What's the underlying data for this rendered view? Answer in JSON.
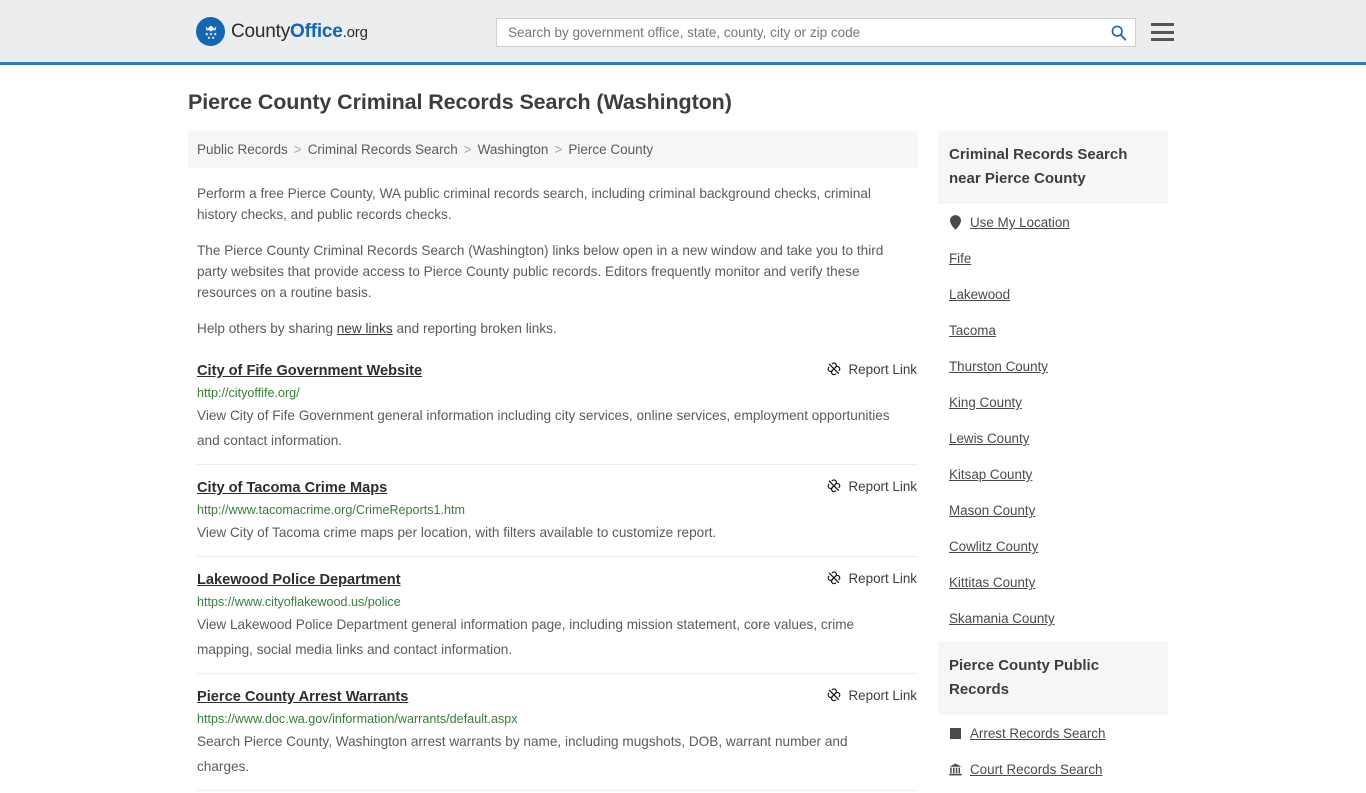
{
  "header": {
    "brand": {
      "part1": "County",
      "part2": "Office",
      "part3": ".org",
      "logo_icon": "eagle-stars-logo"
    },
    "search": {
      "placeholder": "Search by government office, state, county, city or zip code",
      "value": ""
    },
    "menu_label": "Menu"
  },
  "page": {
    "title": "Pierce County Criminal Records Search (Washington)"
  },
  "breadcrumb": [
    {
      "label": "Public Records"
    },
    {
      "label": "Criminal Records Search"
    },
    {
      "label": "Washington"
    },
    {
      "label": "Pierce County"
    }
  ],
  "breadcrumb_separator": ">",
  "intro": {
    "p1": "Perform a free Pierce County, WA public criminal records search, including criminal background checks, criminal history checks, and public records checks.",
    "p2": "The Pierce County Criminal Records Search (Washington) links below open in a new window and take you to third party websites that provide access to Pierce County public records. Editors frequently monitor and verify these resources on a routine basis.",
    "p3_before": "Help others by sharing ",
    "p3_link": "new links",
    "p3_after": " and reporting broken links."
  },
  "report_link_label": "Report Link",
  "results": [
    {
      "title": "City of Fife Government Website",
      "url": "http://cityoffife.org/",
      "description": "View City of Fife Government general information including city services, online services, employment opportunities and contact information."
    },
    {
      "title": "City of Tacoma Crime Maps",
      "url": "http://www.tacomacrime.org/CrimeReports1.htm",
      "description": "View City of Tacoma crime maps per location, with filters available to customize report."
    },
    {
      "title": "Lakewood Police Department",
      "url": "https://www.cityoflakewood.us/police",
      "description": "View Lakewood Police Department general information page, including mission statement, core values, crime mapping, social media links and contact information."
    },
    {
      "title": "Pierce County Arrest Warrants",
      "url": "https://www.doc.wa.gov/information/warrants/default.aspx",
      "description": "Search Pierce County, Washington arrest warrants by name, including mugshots, DOB, warrant number and charges."
    }
  ],
  "sidebar": {
    "nearby": {
      "heading": "Criminal Records Search near Pierce County",
      "items": [
        {
          "label": "Use My Location",
          "icon": "map-pin-icon"
        },
        {
          "label": "Fife",
          "icon": ""
        },
        {
          "label": "Lakewood",
          "icon": ""
        },
        {
          "label": "Tacoma",
          "icon": ""
        },
        {
          "label": "Thurston County",
          "icon": ""
        },
        {
          "label": "King County",
          "icon": ""
        },
        {
          "label": "Lewis County",
          "icon": ""
        },
        {
          "label": "Kitsap County",
          "icon": ""
        },
        {
          "label": "Mason County",
          "icon": ""
        },
        {
          "label": "Cowlitz County",
          "icon": ""
        },
        {
          "label": "Kittitas County",
          "icon": ""
        },
        {
          "label": "Skamania County",
          "icon": ""
        }
      ]
    },
    "public_records": {
      "heading": "Pierce County Public Records",
      "items": [
        {
          "label": "Arrest Records Search",
          "icon": "square-icon"
        },
        {
          "label": "Court Records Search",
          "icon": "courthouse-icon"
        }
      ]
    }
  },
  "colors": {
    "brand_blue": "#1565b0",
    "header_bg": "#ebedef",
    "header_rule": "#3a7cb4",
    "url_green": "#3a7d3a",
    "panel_gray": "#f6f6f6"
  }
}
